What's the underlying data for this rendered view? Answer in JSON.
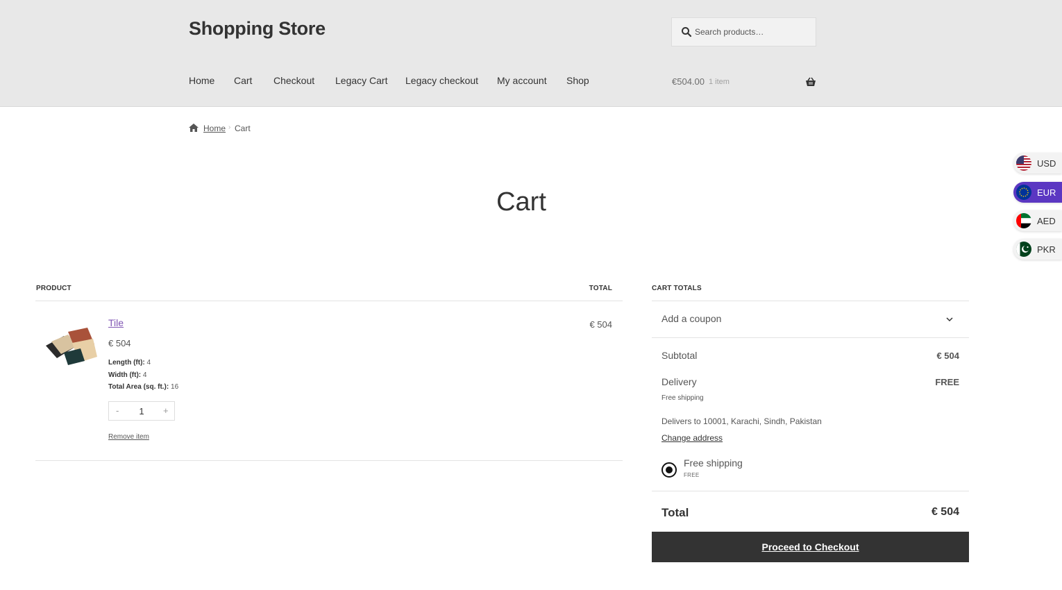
{
  "header": {
    "site_title": "Shopping Store",
    "search": {
      "placeholder": "Search products…",
      "icon": "search-icon"
    },
    "nav": [
      {
        "label": "Home"
      },
      {
        "label": "Cart"
      },
      {
        "label": "Checkout"
      },
      {
        "label": "Legacy Cart"
      },
      {
        "label": "Legacy checkout"
      },
      {
        "label": "My account"
      },
      {
        "label": "Shop"
      }
    ],
    "mini_cart": {
      "amount": "€504.00",
      "count": "1 item",
      "icon": "basket-icon"
    }
  },
  "breadcrumb": {
    "home": "Home",
    "separator": "›",
    "current": "Cart"
  },
  "page_title": "Cart",
  "currency_switcher": [
    {
      "code": "USD",
      "active": false
    },
    {
      "code": "EUR",
      "active": true
    },
    {
      "code": "AED",
      "active": false
    },
    {
      "code": "PKR",
      "active": false
    }
  ],
  "cart_table": {
    "headers": {
      "product": "PRODUCT",
      "total": "TOTAL"
    },
    "items": [
      {
        "name": "Tile",
        "price": "€ 504",
        "meta": [
          {
            "label": "Length (ft):",
            "value": "4"
          },
          {
            "label": "Width (ft):",
            "value": "4"
          },
          {
            "label": "Total Area (sq. ft.):",
            "value": "16"
          }
        ],
        "quantity": "1",
        "minus": "-",
        "plus": "+",
        "remove_label": "Remove item",
        "line_total": "€ 504"
      }
    ]
  },
  "cart_totals": {
    "heading": "CART TOTALS",
    "coupon_label": "Add a coupon",
    "subtotal_label": "Subtotal",
    "subtotal_value": "€ 504",
    "delivery_label": "Delivery",
    "delivery_value": "FREE",
    "delivery_method": "Free shipping",
    "delivers_to": "Delivers to 10001, Karachi, Sindh, Pakistan",
    "change_address": "Change address",
    "shipping_option": {
      "label": "Free shipping",
      "price": "FREE",
      "selected": true
    },
    "total_label": "Total",
    "total_value": "€ 504",
    "checkout_button": "Proceed to Checkout"
  },
  "colors": {
    "header_bg": "#e8e8e8",
    "link_purple": "#7f54b3",
    "active_currency": "#5b37c2",
    "checkout_bg": "#333333"
  }
}
